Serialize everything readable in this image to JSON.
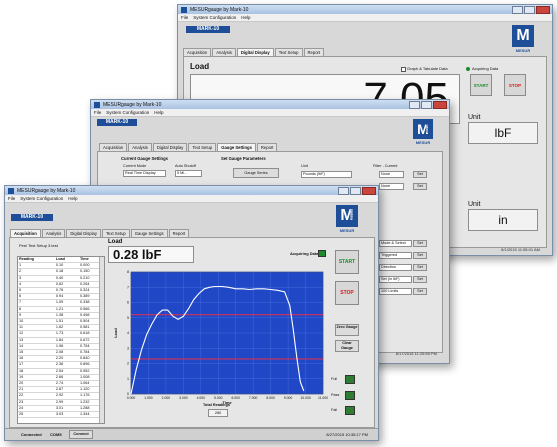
{
  "back_window": {
    "title": "MESURgauge by Mark-10",
    "menu": [
      "File",
      "System Configuration",
      "Help"
    ],
    "brand": "MARK-10",
    "logo_letter": "M",
    "logo_text": "MESUR",
    "tabs": [
      "Acquisition",
      "Analysis",
      "Digital Display",
      "Text Setup",
      "Report"
    ],
    "active_tab": "Digital Display",
    "load_label": "Load",
    "load_value": "7.05",
    "graph_option": "Graph & Tabulate Data",
    "acquiring": "Acquiring Data",
    "start": "START",
    "stop": "STOP",
    "unit_label_1": "Unit",
    "unit_value_1": "lbF",
    "unit_label_2": "Unit",
    "unit_value_2": "in",
    "timestamp": "8/1/2015 11:55:01 AM"
  },
  "mid_window": {
    "title": "MESURgauge by Mark-10",
    "menu": [
      "File",
      "System Configuration",
      "Help"
    ],
    "brand": "MARK-10",
    "logo_letter": "M",
    "logo_text": "MESUR",
    "logo_side": "gauge",
    "tabs": [
      "Acquisition",
      "Analysis",
      "Digital Display",
      "Text Setup",
      "Gauge Settings",
      "Report"
    ],
    "active_tab": "Gauge Settings",
    "current_settings_title": "Current Gauge Settings",
    "current_mode_label": "Current Mode",
    "current_mode_value": "Real Time Display",
    "auto_shutoff_label": "Auto Shutoff",
    "auto_shutoff_value": "5 Mi...",
    "set_params_title": "Set Gauge Parameters",
    "gauge_series": "Gauge Series",
    "unit_label": "Unit",
    "unit_value": "Pounds (lbF)",
    "filter_label": "Filter - Current",
    "filter_values": [
      "None",
      "None"
    ],
    "set": "Set",
    "options": [
      "Mode & Select",
      "Triggered",
      "Direction",
      "Set (in lbF)"
    ],
    "limit_label": "100 Limits",
    "timestamp": "8/17/2015 11:25:55 PM"
  },
  "front_window": {
    "title": "MESURgauge by Mark-10",
    "menu": [
      "File",
      "System Configuration",
      "Help"
    ],
    "brand": "MARK-10",
    "logo_letter": "M",
    "logo_text": "MESUR",
    "logo_side": "gauge",
    "tabs": [
      "Acquisition",
      "Analysis",
      "Digital Display",
      "Text Setup",
      "Gauge Settings",
      "Report"
    ],
    "active_tab": "Acquisition",
    "test_setup": "Peel Test Setup 3.test",
    "load_label": "Load",
    "load_value": "0.28 lbF",
    "acquiring": "Acquiring Data",
    "columns": [
      "Reading",
      "Load",
      "Time"
    ],
    "rows": [
      [
        "1",
        "0.10",
        "0.000"
      ],
      [
        "2",
        "0.18",
        "0.150"
      ],
      [
        "3",
        "0.40",
        "0.210"
      ],
      [
        "4",
        "0.62",
        "0.264"
      ],
      [
        "5",
        "0.76",
        "0.324"
      ],
      [
        "6",
        "0.94",
        "0.389"
      ],
      [
        "7",
        "1.09",
        "0.338"
      ],
      [
        "8",
        "1.21",
        "0.566"
      ],
      [
        "9",
        "1.38",
        "0.498"
      ],
      [
        "10",
        "1.51",
        "0.504"
      ],
      [
        "11",
        "1.62",
        "0.581"
      ],
      [
        "12",
        "1.73",
        "0.618"
      ],
      [
        "13",
        "1.84",
        "0.672"
      ],
      [
        "14",
        "1.96",
        "0.754"
      ],
      [
        "15",
        "2.08",
        "0.784"
      ],
      [
        "16",
        "2.20",
        "0.840"
      ],
      [
        "17",
        "2.36",
        "0.896"
      ],
      [
        "18",
        "2.54",
        "0.952"
      ],
      [
        "19",
        "2.66",
        "1.008"
      ],
      [
        "20",
        "2.74",
        "1.064"
      ],
      [
        "21",
        "2.87",
        "1.120"
      ],
      [
        "22",
        "2.92",
        "1.176"
      ],
      [
        "23",
        "2.99",
        "1.232"
      ],
      [
        "24",
        "3.01",
        "1.288"
      ],
      [
        "25",
        "3.03",
        "1.344"
      ]
    ],
    "start": "START",
    "stop": "STOP",
    "zero_gauge": "Zero Gauge",
    "clear_gauge": "Clear Gauge",
    "full_label": "Full",
    "pass_label": "Pass",
    "fail_label": "Fail",
    "total_readings_label": "Total Readings",
    "total_readings_value": "280",
    "status_connected": "Connected",
    "status_port": "COM5",
    "status_connect_btn": "Connect",
    "timestamp": "8/27/2015 10:35:17 PM"
  },
  "chart_data": {
    "type": "line",
    "xlabel": "Time",
    "ylabel": "Load",
    "xlim": [
      0,
      11
    ],
    "ylim": [
      0,
      8
    ],
    "x_ticks": [
      "0.000",
      "1.000",
      "2.000",
      "3.000",
      "4.000",
      "5.000",
      "6.000",
      "7.000",
      "8.000",
      "9.000",
      "10.000",
      "11.000"
    ],
    "y_ticks": [
      "0",
      "1",
      "2",
      "3",
      "4",
      "5",
      "6",
      "7",
      "8"
    ],
    "limit_lines": [
      2.3,
      5.2
    ],
    "grid": true,
    "series": [
      {
        "x": [
          0,
          0.3,
          0.6,
          0.9,
          1.2,
          1.5,
          1.8,
          2.1,
          2.4,
          2.7,
          3.0,
          3.3,
          3.6,
          3.9,
          4.2,
          4.5,
          4.8,
          5.2,
          5.6,
          6.0,
          6.4,
          6.8,
          7.2,
          7.6,
          8.0,
          8.4,
          8.8,
          9.1,
          9.3,
          9.5,
          9.7,
          9.9
        ],
        "y": [
          0,
          1.6,
          2.9,
          3.9,
          4.6,
          5.2,
          5.5,
          5.5,
          5.1,
          4.9,
          5.1,
          5.6,
          6.2,
          6.6,
          6.9,
          7.0,
          7.05,
          7.05,
          7.0,
          6.9,
          6.9,
          6.85,
          6.9,
          6.9,
          6.85,
          6.8,
          6.7,
          5.8,
          4.2,
          2.4,
          0.8,
          0.2
        ]
      }
    ]
  }
}
